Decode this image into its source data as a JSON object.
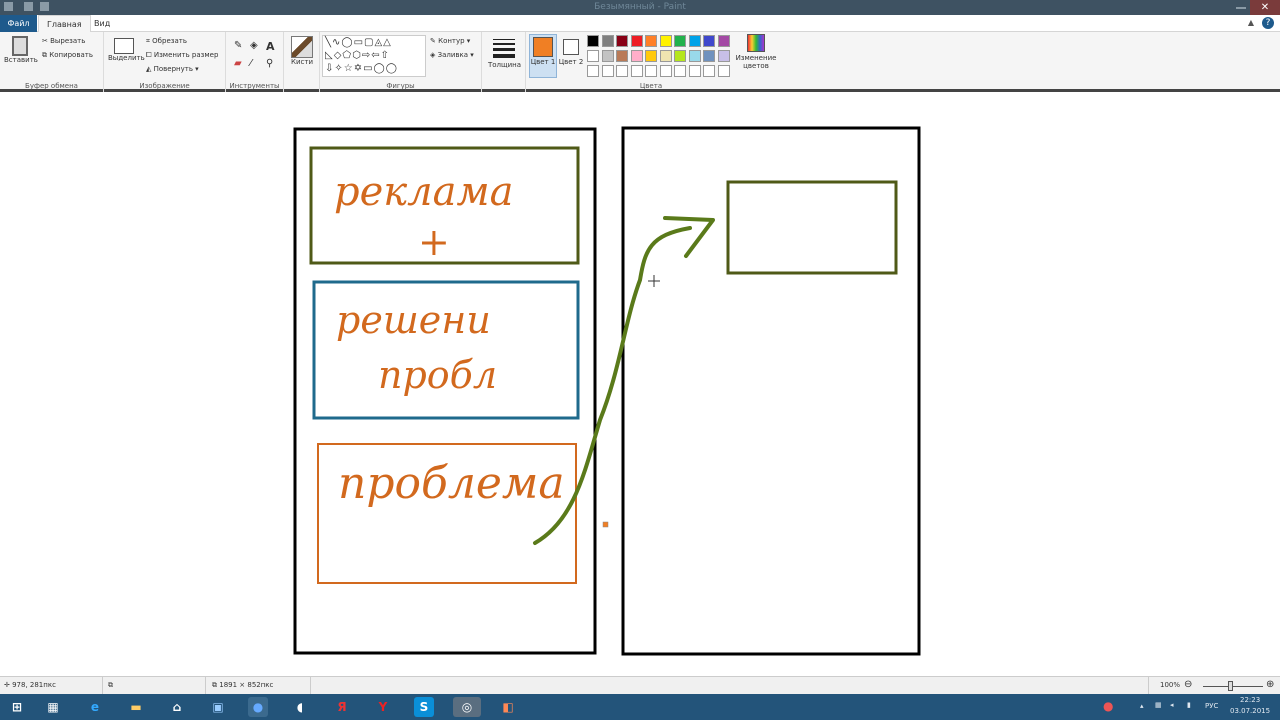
{
  "window": {
    "title": "Безымянный - Paint",
    "close": "✕"
  },
  "tabs": {
    "file": "Файл",
    "home": "Главная",
    "view": "Вид"
  },
  "clipboard": {
    "paste": "Вставить",
    "cut": "Вырезать",
    "copy": "Копировать",
    "label": "Буфер обмена"
  },
  "image": {
    "select": "Выделить",
    "crop": "Обрезать",
    "resize": "Изменить размер",
    "rotate": "Повернуть ▾",
    "label": "Изображение"
  },
  "tools": {
    "label": "Инструменты"
  },
  "brushes": {
    "label": "Кисти"
  },
  "shapes": {
    "outline": "Контур ▾",
    "fill": "Заливка ▾",
    "label": "Фигуры"
  },
  "size": {
    "label": "Толщина"
  },
  "colors": {
    "color1": "Цвет 1",
    "color2": "Цвет 2",
    "edit": "Изменение цветов",
    "label": "Цвета",
    "color1_value": "#f07f24",
    "color2_value": "#ffffff",
    "palette_row1": [
      "#000000",
      "#7f7f7f",
      "#880015",
      "#ed1c24",
      "#ff7f27",
      "#fff200",
      "#22b14c",
      "#00a2e8",
      "#3f48cc",
      "#a349a4"
    ],
    "palette_row2": [
      "#ffffff",
      "#c3c3c3",
      "#b97a57",
      "#ffaec9",
      "#ffc90e",
      "#efe4b0",
      "#b5e61d",
      "#99d9ea",
      "#7092be",
      "#c8bfe7"
    ]
  },
  "drawing": {
    "box1": "реклама",
    "box1_plus": "+",
    "box2_line1": "решени",
    "box2_line2": "пробл",
    "box3": "проблема",
    "colors": {
      "frame": "#000000",
      "olive": "#4f5a17",
      "blue": "#1f6a8c",
      "orange": "#d2691e",
      "arrow": "#5a7a1a"
    }
  },
  "status": {
    "cursor": "978, 281пкс",
    "size": "1891 × 852пкс",
    "zoom": "100%"
  },
  "taskbar": {
    "lang": "РУС",
    "time": "22:23",
    "date": "03.07.2015"
  }
}
